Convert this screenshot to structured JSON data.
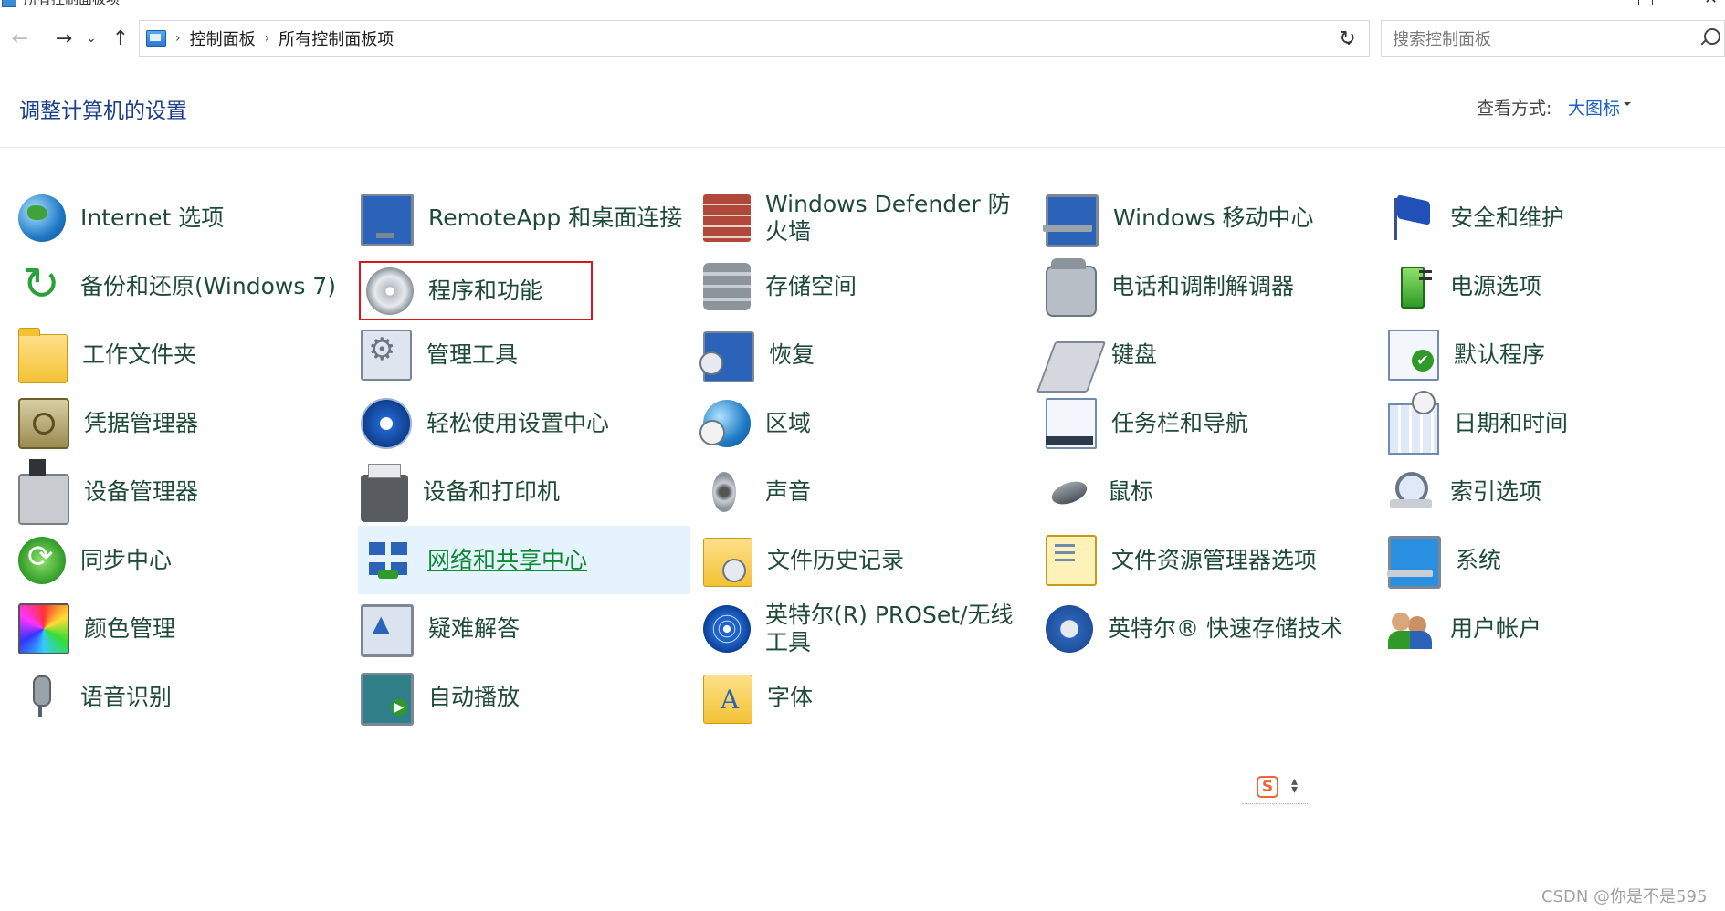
{
  "window": {
    "title": "所有控制面板项"
  },
  "nav": {
    "back": "←",
    "forward": "→",
    "recent": "⌄",
    "up": "↑",
    "refresh": "↻",
    "dropdown": "⌄"
  },
  "breadcrumb": [
    "控制面板",
    "所有控制面板项"
  ],
  "search": {
    "placeholder": "搜索控制面板",
    "value": ""
  },
  "header": {
    "title": "调整计算机的设置",
    "view_label": "查看方式:",
    "view_value": "大图标"
  },
  "items": {
    "col1": [
      {
        "label": "Internet 选项",
        "icon": "globe-icon"
      },
      {
        "label": "备份和还原(Windows 7)",
        "icon": "backup-icon"
      },
      {
        "label": "工作文件夹",
        "icon": "folder-icon"
      },
      {
        "label": "凭据管理器",
        "icon": "safe-icon"
      },
      {
        "label": "设备管理器",
        "icon": "device-icon"
      },
      {
        "label": "同步中心",
        "icon": "sync-icon"
      },
      {
        "label": "颜色管理",
        "icon": "color-icon"
      },
      {
        "label": "语音识别",
        "icon": "microphone-icon"
      }
    ],
    "col2": [
      {
        "label": "RemoteApp 和桌面连接",
        "icon": "monitor-icon"
      },
      {
        "label": "程序和功能",
        "icon": "cd-icon"
      },
      {
        "label": "管理工具",
        "icon": "tools-icon"
      },
      {
        "label": "轻松使用设置中心",
        "icon": "accessibility-icon"
      },
      {
        "label": "设备和打印机",
        "icon": "printer-icon"
      },
      {
        "label": "网络和共享中心",
        "icon": "network-icon"
      },
      {
        "label": "疑难解答",
        "icon": "troubleshoot-icon"
      },
      {
        "label": "自动播放",
        "icon": "autoplay-icon"
      }
    ],
    "col3": [
      {
        "label": "Windows Defender 防火墙",
        "icon": "firewall-icon"
      },
      {
        "label": "存储空间",
        "icon": "storage-icon"
      },
      {
        "label": "恢复",
        "icon": "recovery-icon"
      },
      {
        "label": "区域",
        "icon": "region-icon"
      },
      {
        "label": "声音",
        "icon": "speaker-icon"
      },
      {
        "label": "文件历史记录",
        "icon": "file-history-icon"
      },
      {
        "label": "英特尔(R) PROSet/无线工具",
        "icon": "wifi-icon"
      },
      {
        "label": "字体",
        "icon": "font-icon"
      }
    ],
    "col4": [
      {
        "label": "Windows 移动中心",
        "icon": "laptop-icon"
      },
      {
        "label": "电话和调制解调器",
        "icon": "phone-icon"
      },
      {
        "label": "键盘",
        "icon": "keyboard-icon"
      },
      {
        "label": "任务栏和导航",
        "icon": "taskbar-icon"
      },
      {
        "label": "鼠标",
        "icon": "mouse-icon"
      },
      {
        "label": "文件资源管理器选项",
        "icon": "folder-options-icon"
      },
      {
        "label": "英特尔® 快速存储技术",
        "icon": "rapid-storage-icon"
      }
    ],
    "col5": [
      {
        "label": "安全和维护",
        "icon": "flag-icon"
      },
      {
        "label": "电源选项",
        "icon": "power-icon"
      },
      {
        "label": "默认程序",
        "icon": "default-programs-icon"
      },
      {
        "label": "日期和时间",
        "icon": "datetime-icon"
      },
      {
        "label": "索引选项",
        "icon": "index-icon"
      },
      {
        "label": "系统",
        "icon": "system-icon"
      },
      {
        "label": "用户帐户",
        "icon": "users-icon"
      }
    ]
  },
  "ime": {
    "letter": "S"
  },
  "watermark": "CSDN @你是不是595",
  "colors": {
    "title": "#1a3e8a",
    "link": "#1a5fc4",
    "hover_bg": "#e5f3ff",
    "highlight_box": "#d9151e",
    "hover_text": "#0c8a32"
  }
}
